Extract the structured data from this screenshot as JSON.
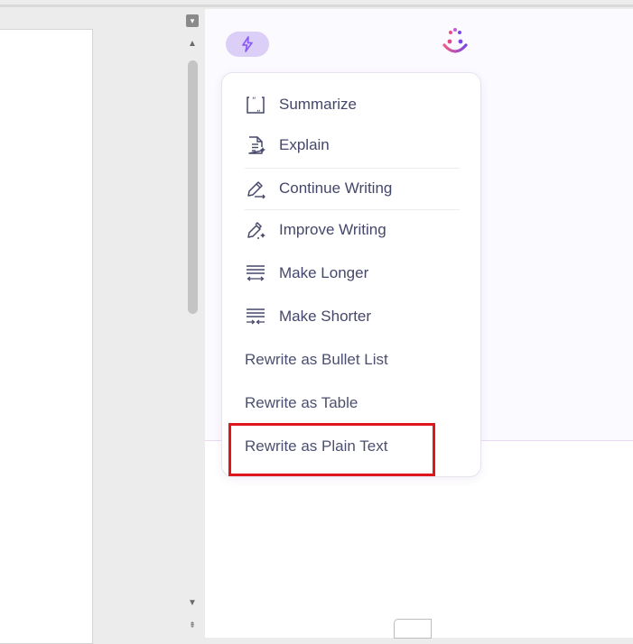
{
  "scrollbar": {
    "top_glyph": "▾",
    "up_glyph": "▲",
    "down_glyph": "▼",
    "end_glyph": "⇞"
  },
  "ai_panel": {
    "badge_icon": "ai-sparkle-icon",
    "logo_icon": "smiley-sparkle-icon",
    "colors": {
      "badge_bg": "#dccff7",
      "accent": "#8b5cf6",
      "logo_pink": "#e94c8a",
      "logo_purple": "#7a45e6"
    }
  },
  "menu": {
    "items": [
      {
        "label": "Summarize",
        "icon": "summarize-icon"
      },
      {
        "label": "Explain",
        "icon": "explain-icon"
      },
      {
        "label": "Continue Writing",
        "icon": "continue-writing-icon"
      },
      {
        "label": "Improve Writing",
        "icon": "improve-writing-icon"
      },
      {
        "label": "Make Longer",
        "icon": "make-longer-icon"
      },
      {
        "label": "Make Shorter",
        "icon": "make-shorter-icon"
      },
      {
        "label": "Rewrite as Bullet List"
      },
      {
        "label": "Rewrite as Table"
      },
      {
        "label": "Rewrite as Plain Text"
      }
    ],
    "highlighted_item": "Rewrite as Plain Text",
    "highlight_color": "#e0161e"
  }
}
